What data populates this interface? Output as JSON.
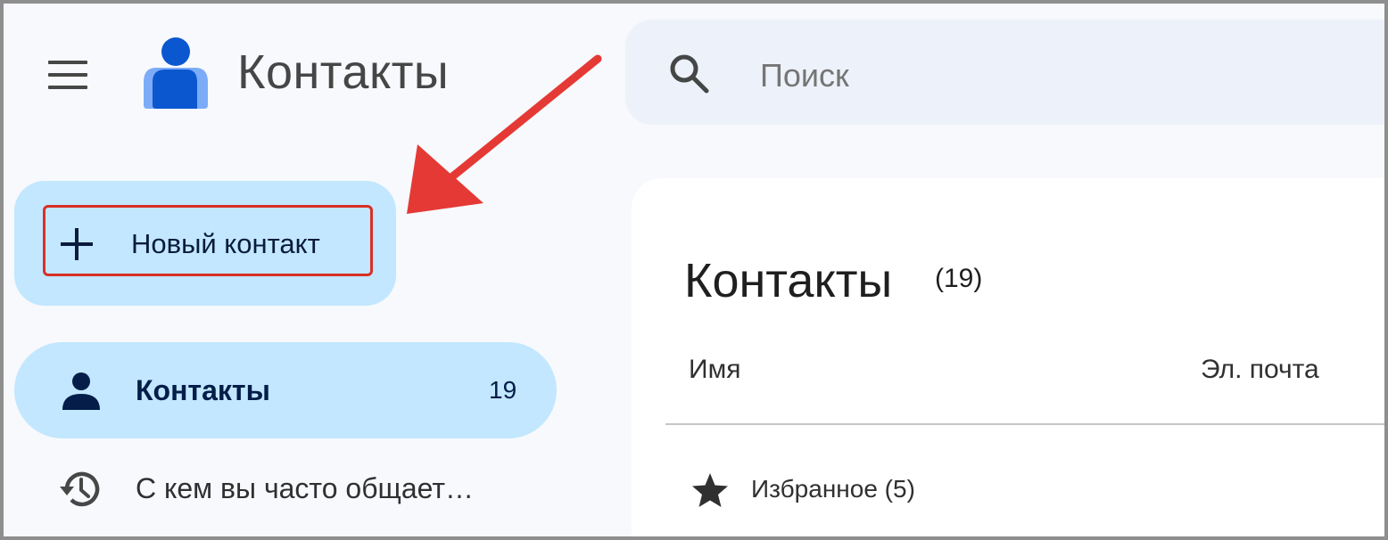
{
  "header": {
    "menu_icon": "hamburger-menu-icon",
    "logo_icon": "contacts-logo-icon",
    "app_title": "Контакты",
    "search": {
      "placeholder": "Поиск",
      "value": "",
      "icon": "search-icon"
    }
  },
  "sidebar": {
    "new_contact": {
      "label": "Новый контакт",
      "icon": "plus-icon"
    },
    "items": [
      {
        "label": "Контакты",
        "count": "19",
        "icon": "person-icon",
        "selected": true
      },
      {
        "label": "С кем вы часто общает…",
        "icon": "history-icon",
        "selected": false
      }
    ]
  },
  "main": {
    "title": "Контакты",
    "count": "(19)",
    "columns": [
      "Имя",
      "Эл. почта"
    ],
    "favorites_label": "Избранное (5)"
  },
  "colors": {
    "accent_bg": "#c2e7ff",
    "highlight": "#d93025",
    "logo_blue": "#0b57d0",
    "logo_light": "#7cacf8",
    "search_bg": "#edf2fa"
  }
}
